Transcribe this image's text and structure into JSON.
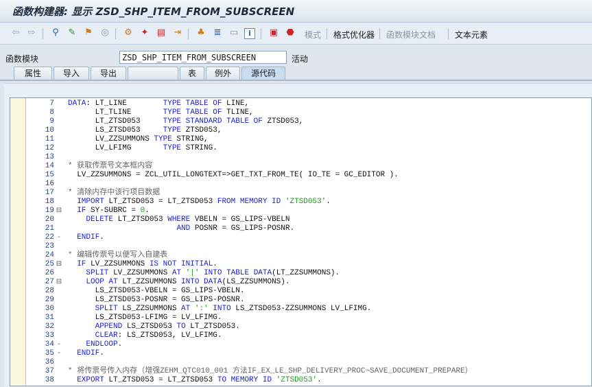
{
  "window": {
    "title": "函数构建器: 显示 ZSD_SHP_ITEM_FROM_SUBSCREEN"
  },
  "toolbar": {
    "icons": [
      "back-arrow-icon",
      "forward-arrow-icon",
      "other-object-icon",
      "display-change-icon",
      "activate-icon",
      "check-icon",
      "test-icon",
      "hierarchy-icon",
      "where-used-icon",
      "navigate-icon",
      "info-icon",
      "pattern-icon",
      "pretty-printer-icon",
      "stop-icon",
      "sap-icon"
    ],
    "buttons": [
      {
        "label": "模式",
        "enabled": false
      },
      {
        "label": "格式优化器",
        "enabled": true
      },
      {
        "label": "函数模块文档",
        "enabled": false
      },
      {
        "label": "文本元素",
        "enabled": true
      }
    ]
  },
  "header": {
    "field_label": "函数模块",
    "field_value": "ZSD_SHP_ITEM_FROM_SUBSCREEN",
    "status": "活动"
  },
  "tabs": [
    {
      "label": "属性",
      "active": false
    },
    {
      "label": "导入",
      "active": false
    },
    {
      "label": "导出",
      "active": false
    },
    {
      "label": "",
      "active": false
    },
    {
      "label": "表",
      "active": false
    },
    {
      "label": "例外",
      "active": false
    },
    {
      "label": "源代码",
      "active": true
    }
  ],
  "colors": {
    "keyword": "#1a1fd0",
    "string": "#1f9a1f",
    "comment": "#666666",
    "line_number": "#1f3f9a"
  },
  "code_lines": [
    {
      "n": "7",
      "m": "",
      "segs": [
        [
          "k",
          "DATA"
        ],
        [
          "p",
          ": LT_LINE        "
        ],
        [
          "k",
          "TYPE TABLE OF"
        ],
        [
          "p",
          " LINE,"
        ]
      ]
    },
    {
      "n": "8",
      "m": "",
      "segs": [
        [
          "p",
          "      LT_TLINE       "
        ],
        [
          "k",
          "TYPE TABLE OF"
        ],
        [
          "p",
          " TLINE,"
        ]
      ]
    },
    {
      "n": "9",
      "m": "",
      "segs": [
        [
          "p",
          "      LT_ZTSD053     "
        ],
        [
          "k",
          "TYPE STANDARD TABLE OF"
        ],
        [
          "p",
          " ZTSD053,"
        ]
      ]
    },
    {
      "n": "10",
      "m": "",
      "segs": [
        [
          "p",
          "      LS_ZTSD053     "
        ],
        [
          "k",
          "TYPE"
        ],
        [
          "p",
          " ZTSD053,"
        ]
      ]
    },
    {
      "n": "11",
      "m": "",
      "segs": [
        [
          "p",
          "      LV_ZZSUMMONS "
        ],
        [
          "k",
          "TYPE"
        ],
        [
          "p",
          " STRING,"
        ]
      ]
    },
    {
      "n": "12",
      "m": "",
      "segs": [
        [
          "p",
          "      LV_LFIMG       "
        ],
        [
          "k",
          "TYPE"
        ],
        [
          "p",
          " STRING."
        ]
      ]
    },
    {
      "n": "13",
      "m": "",
      "segs": []
    },
    {
      "n": "14",
      "m": "",
      "segs": [
        [
          "c",
          "* 获取传票号文本框内容"
        ]
      ]
    },
    {
      "n": "15",
      "m": "",
      "segs": [
        [
          "p",
          "  LV_ZZSUMMONS = ZCL_UTIL_LONGTEXT=>GET_TXT_FROM_TE( IO_TE = GC_EDITOR )."
        ]
      ]
    },
    {
      "n": "16",
      "m": "",
      "segs": []
    },
    {
      "n": "17",
      "m": "",
      "segs": [
        [
          "c",
          "* 清除内存中该行项目数据"
        ]
      ]
    },
    {
      "n": "18",
      "m": "",
      "segs": [
        [
          "p",
          "  "
        ],
        [
          "k",
          "IMPORT"
        ],
        [
          "p",
          " LT_ZTSD053 = LT_ZTSD053 "
        ],
        [
          "k",
          "FROM MEMORY ID"
        ],
        [
          "p",
          " "
        ],
        [
          "s",
          "'ZTSD053'"
        ],
        [
          "p",
          "."
        ]
      ]
    },
    {
      "n": "19",
      "m": "⊟",
      "segs": [
        [
          "p",
          "  "
        ],
        [
          "k",
          "IF"
        ],
        [
          "p",
          " SY-SUBRC = "
        ],
        [
          "s",
          "0"
        ],
        [
          "p",
          "."
        ]
      ]
    },
    {
      "n": "20",
      "m": "",
      "segs": [
        [
          "p",
          "    "
        ],
        [
          "k",
          "DELETE"
        ],
        [
          "p",
          " LT_ZTSD053 "
        ],
        [
          "k",
          "WHERE"
        ],
        [
          "p",
          " VBELN = GS_LIPS-VBELN"
        ]
      ]
    },
    {
      "n": "21",
      "m": "",
      "segs": [
        [
          "p",
          "                        "
        ],
        [
          "k",
          "AND"
        ],
        [
          "p",
          " POSNR = GS_LIPS-POSNR."
        ]
      ]
    },
    {
      "n": "22",
      "m": "-",
      "segs": [
        [
          "p",
          "  "
        ],
        [
          "k",
          "ENDIF"
        ],
        [
          "p",
          "."
        ]
      ]
    },
    {
      "n": "23",
      "m": "",
      "segs": []
    },
    {
      "n": "24",
      "m": "",
      "segs": [
        [
          "c",
          "* 编辑传票号以便写入自建表"
        ]
      ]
    },
    {
      "n": "25",
      "m": "⊟",
      "segs": [
        [
          "p",
          "  "
        ],
        [
          "k",
          "IF"
        ],
        [
          "p",
          " LV_ZZSUMMONS "
        ],
        [
          "k",
          "IS NOT INITIAL"
        ],
        [
          "p",
          "."
        ]
      ]
    },
    {
      "n": "26",
      "m": "",
      "segs": [
        [
          "p",
          "    "
        ],
        [
          "k",
          "SPLIT"
        ],
        [
          "p",
          " LV_ZZSUMMONS "
        ],
        [
          "k",
          "AT"
        ],
        [
          "p",
          " "
        ],
        [
          "s",
          "'|'"
        ],
        [
          "p",
          " "
        ],
        [
          "k",
          "INTO TABLE DATA"
        ],
        [
          "p",
          "(LT_ZZSUMMONS)."
        ]
      ]
    },
    {
      "n": "27",
      "m": "⊟",
      "segs": [
        [
          "p",
          "    "
        ],
        [
          "k",
          "LOOP AT"
        ],
        [
          "p",
          " LT_ZZSUMMONS "
        ],
        [
          "k",
          "INTO DATA"
        ],
        [
          "p",
          "(LS_ZZSUMMONS)."
        ]
      ]
    },
    {
      "n": "28",
      "m": "",
      "segs": [
        [
          "p",
          "      LS_ZTSD053-VBELN = GS_LIPS-VBELN."
        ]
      ]
    },
    {
      "n": "29",
      "m": "",
      "segs": [
        [
          "p",
          "      LS_ZTSD053-POSNR = GS_LIPS-POSNR."
        ]
      ]
    },
    {
      "n": "30",
      "m": "",
      "segs": [
        [
          "p",
          "      "
        ],
        [
          "k",
          "SPLIT"
        ],
        [
          "p",
          " LS_ZZSUMMONS "
        ],
        [
          "k",
          "AT"
        ],
        [
          "p",
          " "
        ],
        [
          "s",
          "':'"
        ],
        [
          "p",
          " "
        ],
        [
          "k",
          "INTO"
        ],
        [
          "p",
          " LS_ZTSD053-ZZSUMMONS LV_LFIMG."
        ]
      ]
    },
    {
      "n": "31",
      "m": "",
      "segs": [
        [
          "p",
          "      LS_ZTSD053-LFIMG = LV_LFIMG."
        ]
      ]
    },
    {
      "n": "32",
      "m": "",
      "segs": [
        [
          "p",
          "      "
        ],
        [
          "k",
          "APPEND"
        ],
        [
          "p",
          " LS_ZTSD053 "
        ],
        [
          "k",
          "TO"
        ],
        [
          "p",
          " LT_ZTSD053."
        ]
      ]
    },
    {
      "n": "33",
      "m": "",
      "segs": [
        [
          "p",
          "      "
        ],
        [
          "k",
          "CLEAR"
        ],
        [
          "p",
          ": LS_ZTSD053, LV_LFIMG."
        ]
      ]
    },
    {
      "n": "34",
      "m": "-",
      "segs": [
        [
          "p",
          "    "
        ],
        [
          "k",
          "ENDLOOP"
        ],
        [
          "p",
          "."
        ]
      ]
    },
    {
      "n": "35",
      "m": "-",
      "segs": [
        [
          "p",
          "  "
        ],
        [
          "k",
          "ENDIF"
        ],
        [
          "p",
          "."
        ]
      ]
    },
    {
      "n": "36",
      "m": "",
      "segs": []
    },
    {
      "n": "37",
      "m": "",
      "segs": [
        [
          "c",
          "* 将传票号传入内存（增强ZEHM_QTC010_001 方法IF_EX_LE_SHP_DELIVERY_PROC~SAVE_DOCUMENT_PREPARE）"
        ]
      ]
    },
    {
      "n": "38",
      "m": "",
      "segs": [
        [
          "p",
          "  "
        ],
        [
          "k",
          "EXPORT"
        ],
        [
          "p",
          " LT_ZTSD053 = LT_ZTSD053 "
        ],
        [
          "k",
          "TO MEMORY ID"
        ],
        [
          "p",
          " "
        ],
        [
          "s",
          "'ZTSD053'"
        ],
        [
          "p",
          "."
        ]
      ]
    }
  ]
}
